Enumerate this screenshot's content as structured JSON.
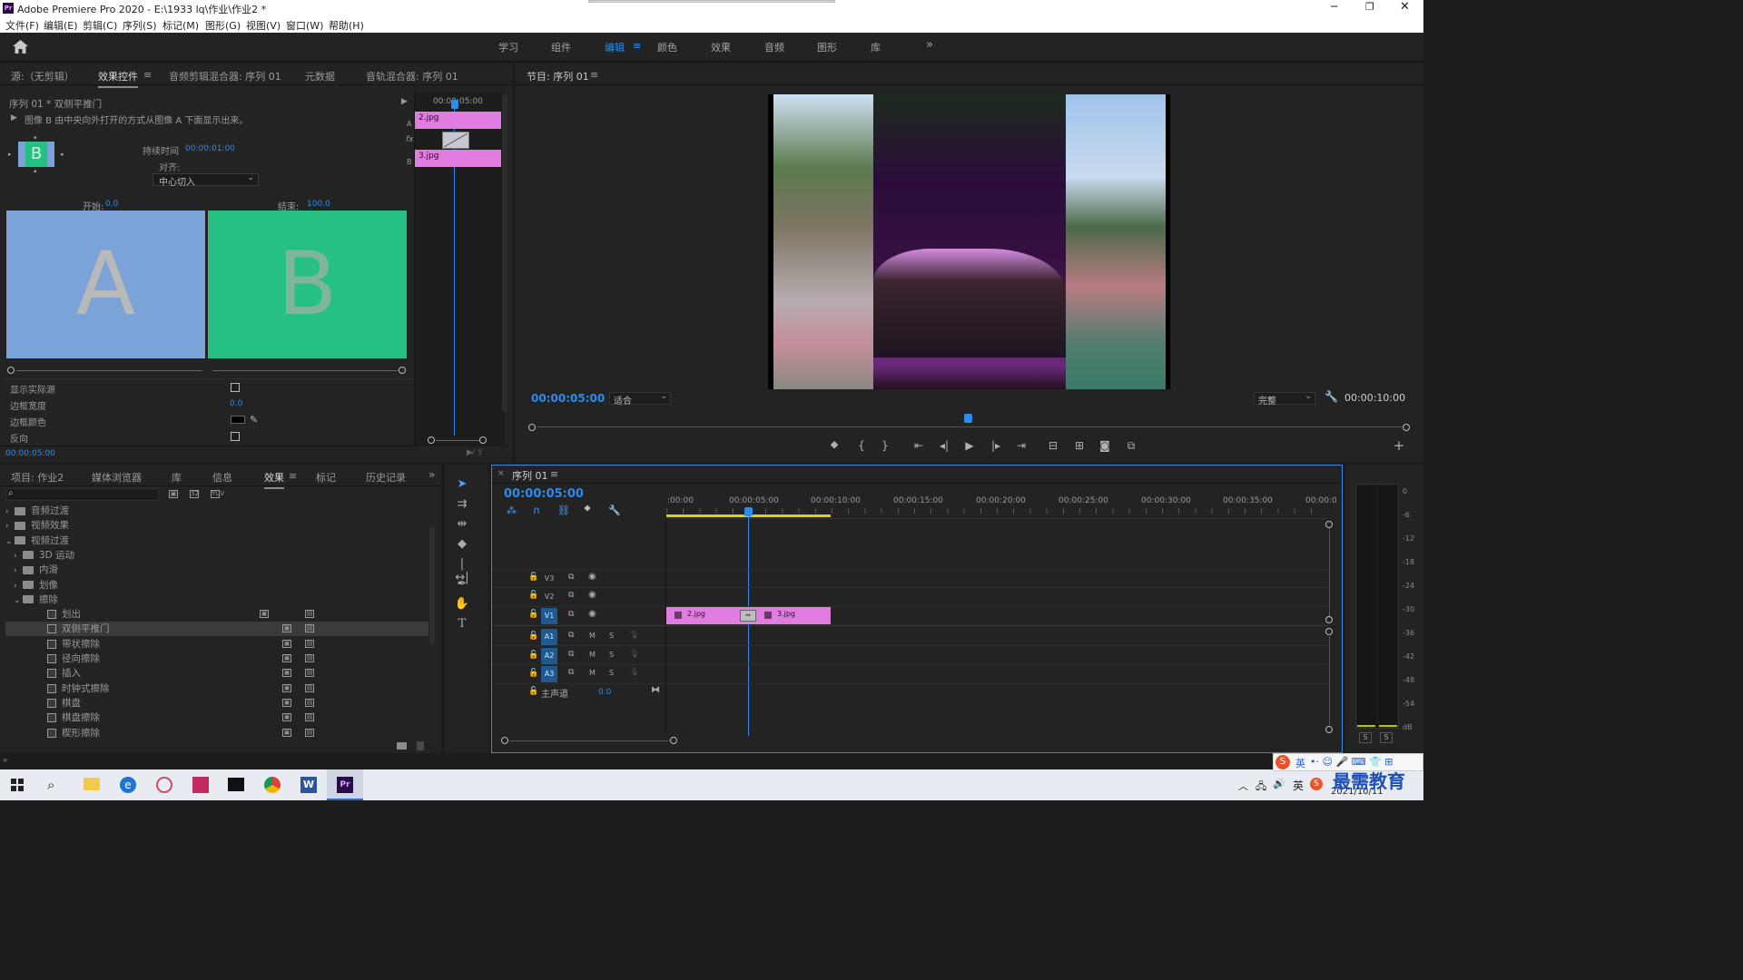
{
  "app": {
    "title": "Adobe Premiere Pro 2020 - E:\\1933 lq\\作业\\作业2 *",
    "logo_text": "Pr",
    "menu": [
      "文件(F)",
      "编辑(E)",
      "剪辑(C)",
      "序列(S)",
      "标记(M)",
      "图形(G)",
      "视图(V)",
      "窗口(W)",
      "帮助(H)"
    ],
    "workspaces": [
      "学习",
      "组件",
      "编辑",
      "颜色",
      "效果",
      "音频",
      "图形",
      "库"
    ],
    "active_workspace": "编辑",
    "more": "»"
  },
  "effect_controls": {
    "tabs": [
      "源:（无剪辑）",
      "效果控件",
      "音频剪辑混合器: 序列 01",
      "元数据",
      "音轨混合器: 序列 01"
    ],
    "active_tab": "效果控件",
    "clip_name": "序列 01 * 双侧平推门",
    "description": "图像 B 由中央向外打开的方式从图像 A 下面显示出来。",
    "thumb_letter": "B",
    "duration_label": "持续时间",
    "duration_value": "00:00:01:00",
    "align_label": "对齐:",
    "align_value": "中心切入",
    "start_label": "开始:",
    "start_value": "0.0",
    "end_label": "结束:",
    "end_value": "100.0",
    "preview_a": "A",
    "preview_b": "B",
    "show_actual": "显示实际源",
    "border_width_label": "边框宽度",
    "border_width_value": "0.0",
    "border_color_label": "边框颜色",
    "reverse_label": "反向",
    "timecode": "00:00:05:00",
    "mini_timecode": "00:00:05:00",
    "clip_a": "2.jpg",
    "clip_b": "3.jpg",
    "track_a": "A",
    "track_b": "B",
    "fx_label": "fx",
    "colors": {
      "a_bg": "#7ba3d8",
      "b_bg": "#27c083",
      "thumb": "#27c083"
    }
  },
  "program_monitor": {
    "title": "节目: 序列 01",
    "timecode": "00:00:05:00",
    "fit": "适合",
    "quality": "完整",
    "duration": "00:00:10:00"
  },
  "project": {
    "tabs": [
      "项目: 作业2",
      "媒体浏览器",
      "库",
      "信息",
      "效果",
      "标记",
      "历史记录"
    ],
    "active_tab": "效果",
    "tree": [
      {
        "label": "音频过渡",
        "level": 0,
        "type": "folder",
        "open": false
      },
      {
        "label": "视频效果",
        "level": 0,
        "type": "folder",
        "open": false
      },
      {
        "label": "视频过渡",
        "level": 0,
        "type": "folder",
        "open": true
      },
      {
        "label": "3D 运动",
        "level": 1,
        "type": "folder",
        "open": false
      },
      {
        "label": "内滑",
        "level": 1,
        "type": "folder",
        "open": false
      },
      {
        "label": "划像",
        "level": 1,
        "type": "folder",
        "open": false
      },
      {
        "label": "擦除",
        "level": 1,
        "type": "folder",
        "open": true
      },
      {
        "label": "划出",
        "level": 2,
        "type": "fx"
      },
      {
        "label": "双侧平推门",
        "level": 2,
        "type": "fx",
        "selected": true
      },
      {
        "label": "带状擦除",
        "level": 2,
        "type": "fx"
      },
      {
        "label": "径向擦除",
        "level": 2,
        "type": "fx"
      },
      {
        "label": "插入",
        "level": 2,
        "type": "fx"
      },
      {
        "label": "时钟式擦除",
        "level": 2,
        "type": "fx"
      },
      {
        "label": "棋盘",
        "level": 2,
        "type": "fx"
      },
      {
        "label": "棋盘擦除",
        "level": 2,
        "type": "fx"
      },
      {
        "label": "楔形擦除",
        "level": 2,
        "type": "fx"
      }
    ]
  },
  "timeline": {
    "title": "序列 01",
    "timecode": "00:00:05:00",
    "ruler": [
      ":00:00",
      "00:00:05:00",
      "00:00:10:00",
      "00:00:15:00",
      "00:00:20:00",
      "00:00:25:00",
      "00:00:30:00",
      "00:00:35:00",
      "00:00:0"
    ],
    "video_tracks": [
      "V3",
      "V2",
      "V1"
    ],
    "audio_tracks": [
      "A1",
      "A2",
      "A3"
    ],
    "master_label": "主声道",
    "master_value": "0.0",
    "clips": [
      {
        "name": "2.jpg"
      },
      {
        "name": "3.jpg"
      }
    ],
    "mute": "M",
    "solo": "S"
  },
  "audio_meter": {
    "scale": [
      "0",
      "-6",
      "-12",
      "-18",
      "-24",
      "-30",
      "-36",
      "-42",
      "-48",
      "-54",
      "dB"
    ],
    "solo_a": "S",
    "solo_b": "S"
  },
  "taskbar": {
    "date": "2021/10/11",
    "lang": "英",
    "watermark": "最需教育"
  }
}
